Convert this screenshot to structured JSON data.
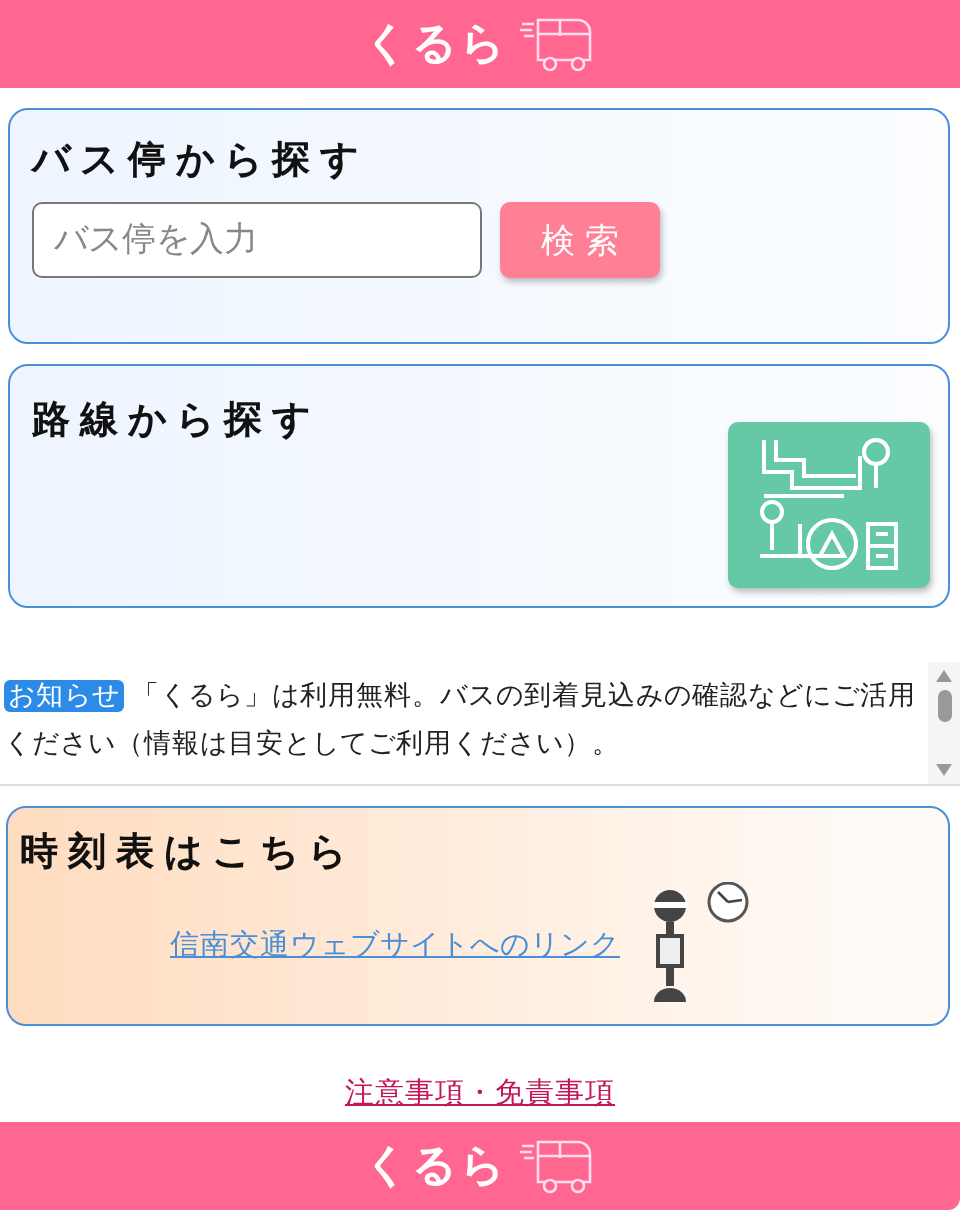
{
  "header": {
    "logo": "くるら"
  },
  "stop_search": {
    "title": "バス停から探す",
    "placeholder": "バス停を入力",
    "button": "検 索"
  },
  "route_search": {
    "title": "路線から探す"
  },
  "notice": {
    "badge": "お知らせ",
    "text": "「くるら」は利用無料。バスの到着見込みの確認などにご活用ください（情報は目安としてご利用ください）。"
  },
  "timetable": {
    "title": "時刻表はこちら",
    "link": "信南交通ウェブサイトへのリンク"
  },
  "disclaimer_link": "注意事項・免責事項",
  "footer": {
    "logo": "くるら"
  }
}
